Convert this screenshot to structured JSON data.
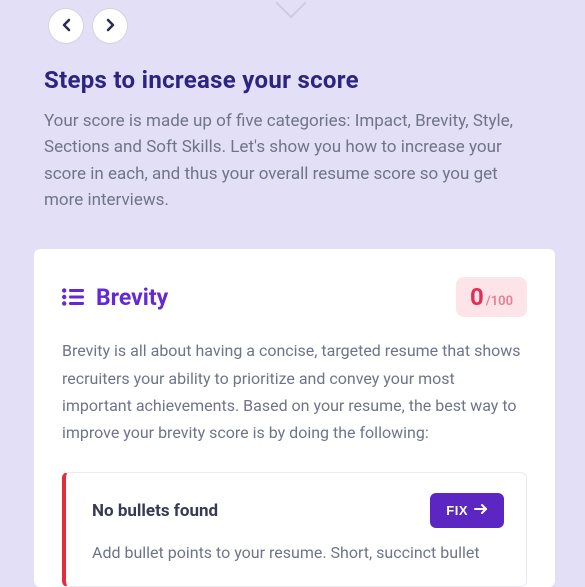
{
  "nav": {
    "prev": "prev",
    "next": "next"
  },
  "section": {
    "title": "Steps to increase your score",
    "description": "Your score is made up of five categories: Impact, Brevity, Style, Sections and Soft Skills. Let's show you how to increase your score in each, and thus your overall resume score so you get more interviews."
  },
  "card": {
    "title": "Brevity",
    "score_value": "0",
    "score_max": "/100",
    "description": "Brevity is all about having a concise, targeted resume that shows recruiters your ability to prioritize and convey your most important achievements. Based on your resume, the best way to improve your brevity score is by doing the following:",
    "issue": {
      "title": "No bullets found",
      "fix_label": "FIX",
      "description": "Add bullet points to your resume. Short, succinct bullet"
    }
  }
}
